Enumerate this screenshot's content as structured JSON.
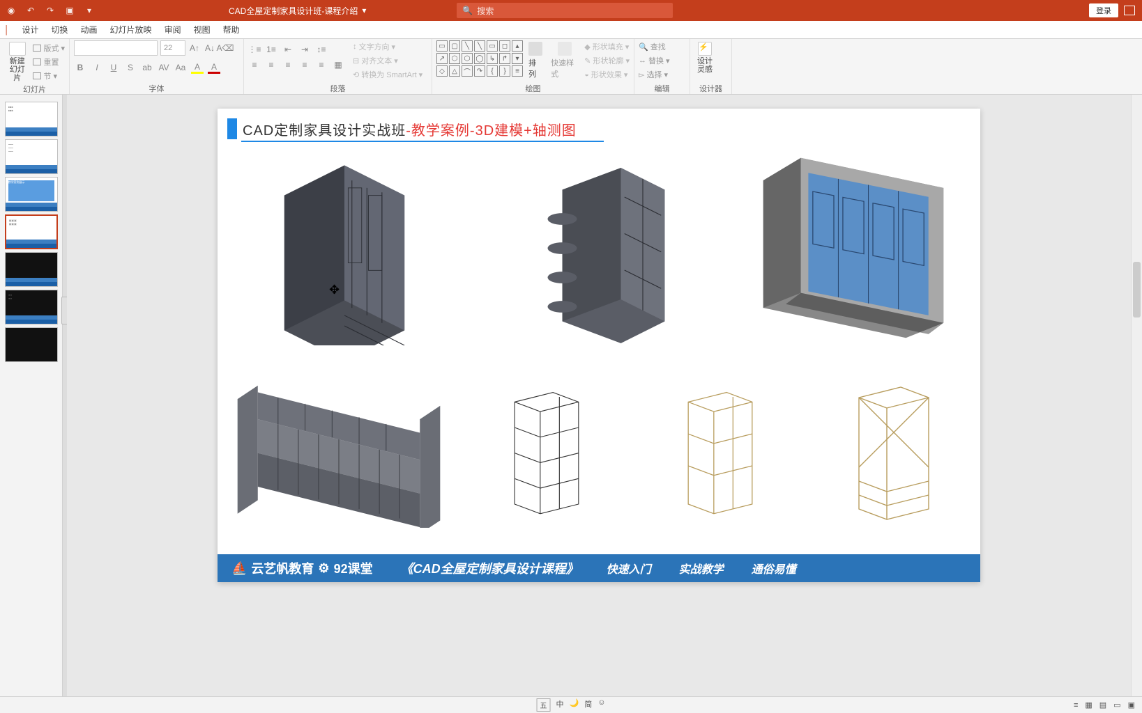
{
  "titlebar": {
    "doc_title": "CAD全屋定制家具设计班-课程介绍",
    "search_placeholder": "搜索",
    "login": "登录"
  },
  "tabs": [
    "设计",
    "切换",
    "动画",
    "幻灯片放映",
    "审阅",
    "视图",
    "帮助"
  ],
  "ribbon": {
    "slides": {
      "new_slide": "新建\n幻灯片",
      "layout": "版式",
      "reset": "重置",
      "section": "节",
      "label": "幻灯片"
    },
    "font": {
      "size": "22",
      "label": "字体"
    },
    "paragraph": {
      "text_direction": "文字方向",
      "align_text": "对齐文本",
      "smartart": "转换为 SmartArt",
      "label": "段落"
    },
    "drawing": {
      "arrange": "排列",
      "quick_styles": "快速样式",
      "shape_fill": "形状填充",
      "shape_outline": "形状轮廓",
      "shape_effects": "形状效果",
      "label": "绘图"
    },
    "editing": {
      "find": "查找",
      "replace": "替换",
      "select": "选择",
      "label": "编辑"
    },
    "designer": {
      "label": "设计\n灵感",
      "group_label": "设计器"
    }
  },
  "slide_content": {
    "title_black": "CAD定制家具设计实战班",
    "title_sep": "-",
    "title_red1": "教学案例",
    "title_red2": "-3D建模+轴测图",
    "footer_brand1": "云艺帆教育",
    "footer_brand2": "92课堂",
    "footer_course": "《CAD全屋定制家具设计课程》",
    "footer_tag1": "快速入门",
    "footer_tag2": "实战教学",
    "footer_tag3": "通俗易懂"
  },
  "statusbar": {
    "ime": [
      "五",
      "中",
      "🌙",
      "简",
      "☺"
    ]
  }
}
